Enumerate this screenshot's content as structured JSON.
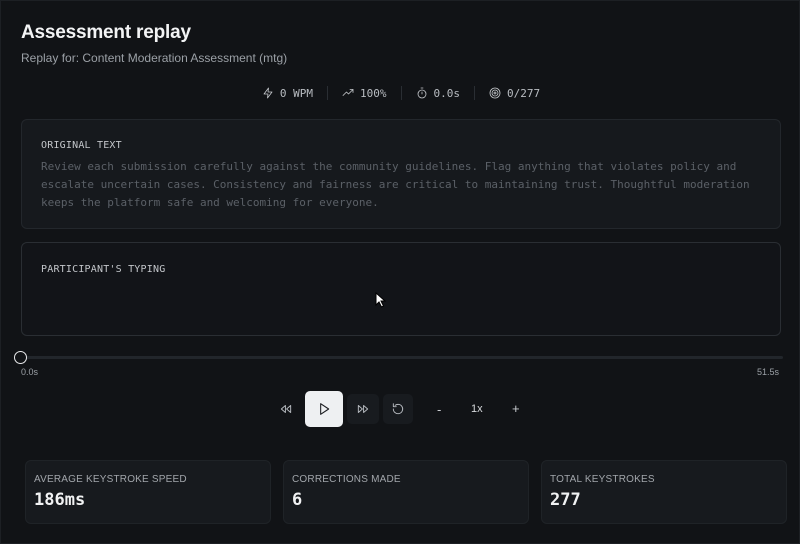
{
  "header": {
    "title": "Assessment replay",
    "subtitle": "Replay for: Content Moderation Assessment (mtg)"
  },
  "stats": {
    "wpm": "0 WPM",
    "accuracy": "100%",
    "time": "0.0s",
    "progress": "0/277"
  },
  "original": {
    "label": "ORIGINAL TEXT",
    "text": "Review each submission carefully against the community guidelines. Flag anything that violates policy and escalate uncertain cases. Consistency and fairness are critical to maintaining trust. Thoughtful moderation keeps the platform safe and welcoming for everyone."
  },
  "typing": {
    "label": "PARTICIPANT'S TYPING"
  },
  "timeline": {
    "start": "0.0s",
    "end": "51.5s",
    "position_fraction": 0.0
  },
  "controls": {
    "speed_minus": "-",
    "speed": "1x",
    "speed_plus": "+"
  },
  "metrics": [
    {
      "label": "AVERAGE KEYSTROKE SPEED",
      "value": "186ms"
    },
    {
      "label": "CORRECTIONS MADE",
      "value": "6"
    },
    {
      "label": "TOTAL KEYSTROKES",
      "value": "277"
    }
  ],
  "icons": {
    "wpm": "lightning-icon",
    "accuracy": "trend-up-icon",
    "time": "stopwatch-icon",
    "progress": "target-icon",
    "rewind": "rewind-icon",
    "play": "play-icon",
    "forward": "fast-forward-icon",
    "restart": "restart-icon"
  },
  "colors": {
    "background": "#111316",
    "panel": "#16191d",
    "play_button": "#eef0f2"
  }
}
